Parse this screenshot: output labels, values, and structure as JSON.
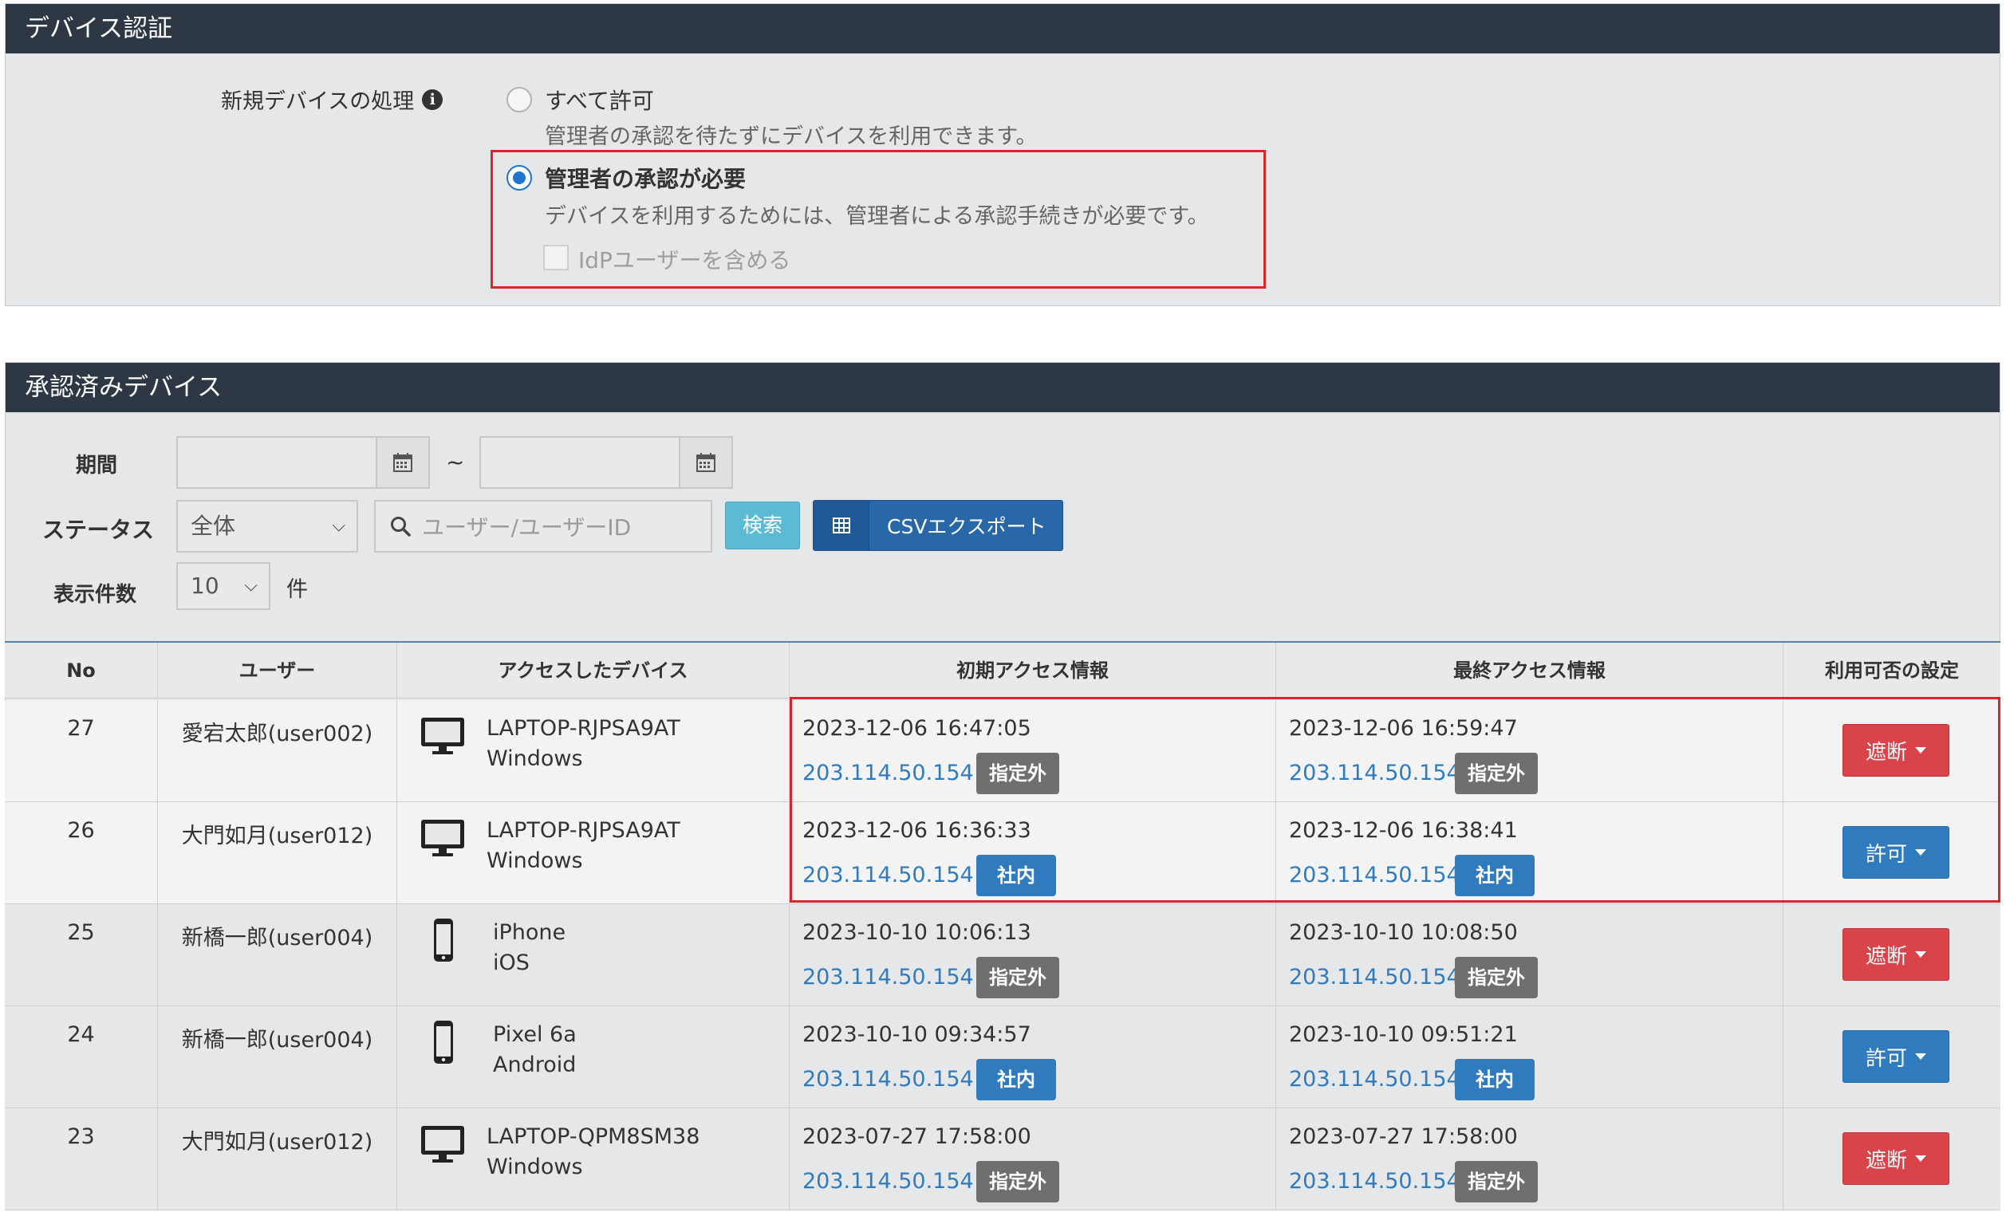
{
  "auth_panel": {
    "title": "デバイス認証",
    "setting_label": "新規デバイスの処理",
    "option_allow": {
      "label": "すべて許可",
      "desc": "管理者の承認を待たずにデバイスを利用できます。"
    },
    "option_approval": {
      "label": "管理者の承認が必要",
      "desc": "デバイスを利用するためには、管理者による承認手続きが必要です。"
    },
    "idp_checkbox_label": "IdPユーザーを含める"
  },
  "devices_panel": {
    "title": "承認済みデバイス",
    "period_label": "期間",
    "tilde": "~",
    "status_label": "ステータス",
    "status_value": "全体",
    "search_placeholder": "ユーザー/ユーザーID",
    "search_button": "検索",
    "csv_button": "CSVエクスポート",
    "count_label": "表示件数",
    "count_value": "10",
    "count_unit": "件"
  },
  "table": {
    "headers": {
      "no": "No",
      "user": "ユーザー",
      "device": "アクセスしたデバイス",
      "first": "初期アクセス情報",
      "last": "最終アクセス情報",
      "setting": "利用可否の設定"
    },
    "rows": [
      {
        "no": "27",
        "user": "愛宕太郎(user002)",
        "device_type": "desktop-icon",
        "device_name": "LAPTOP-RJPSA9AT",
        "os": "Windows",
        "first_time": "2023-12-06 16:47:05",
        "first_ip": "203.114.50.154",
        "first_badge": "指定外",
        "last_time": "2023-12-06 16:59:47",
        "last_ip": "203.114.50.154",
        "last_badge": "指定外",
        "action": "遮断"
      },
      {
        "no": "26",
        "user": "大門如月(user012)",
        "device_type": "desktop-icon",
        "device_name": "LAPTOP-RJPSA9AT",
        "os": "Windows",
        "first_time": "2023-12-06 16:36:33",
        "first_ip": "203.114.50.154",
        "first_badge": "社内",
        "last_time": "2023-12-06 16:38:41",
        "last_ip": "203.114.50.154",
        "last_badge": "社内",
        "action": "許可"
      },
      {
        "no": "25",
        "user": "新橋一郎(user004)",
        "device_type": "phone-icon",
        "device_name": "iPhone",
        "os": "iOS",
        "first_time": "2023-10-10 10:06:13",
        "first_ip": "203.114.50.154",
        "first_badge": "指定外",
        "last_time": "2023-10-10 10:08:50",
        "last_ip": "203.114.50.154",
        "last_badge": "指定外",
        "action": "遮断"
      },
      {
        "no": "24",
        "user": "新橋一郎(user004)",
        "device_type": "phone-icon",
        "device_name": "Pixel 6a",
        "os": "Android",
        "first_time": "2023-10-10 09:34:57",
        "first_ip": "203.114.50.154",
        "first_badge": "社内",
        "last_time": "2023-10-10 09:51:21",
        "last_ip": "203.114.50.154",
        "last_badge": "社内",
        "action": "許可"
      },
      {
        "no": "23",
        "user": "大門如月(user012)",
        "device_type": "desktop-icon",
        "device_name": "LAPTOP-QPM8SM38",
        "os": "Windows",
        "first_time": "2023-07-27 17:58:00",
        "first_ip": "203.114.50.154",
        "first_badge": "指定外",
        "last_time": "2023-07-27 17:58:00",
        "last_ip": "203.114.50.154",
        "last_badge": "指定外",
        "action": "遮断"
      }
    ]
  },
  "colors": {
    "header_bg": "#2e3744",
    "highlight": "#d9262c",
    "link": "#2f7bbd",
    "block_red": "#d9434a",
    "allow_blue": "#2f7bbd",
    "badge_gray": "#6f6f6f"
  }
}
